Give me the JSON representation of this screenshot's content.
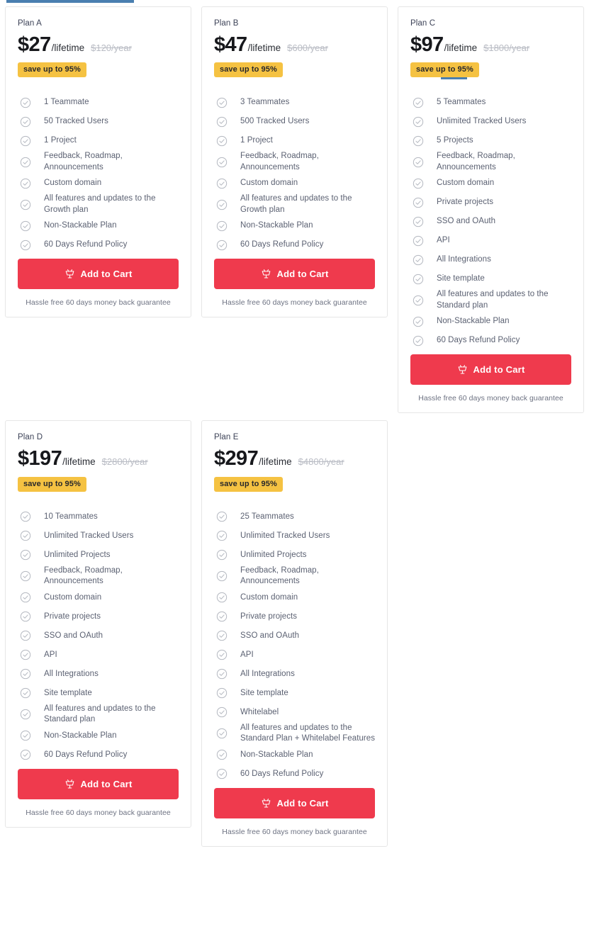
{
  "page": {
    "loading_bar_color": "#4a7fb0",
    "accent_button_color": "#ef3a4d",
    "badge_color": "#f5c242"
  },
  "common": {
    "cart_label": "Add to Cart",
    "cart_icon": "shopping-cart-icon",
    "guarantee": "Hassle free 60 days money back guarantee",
    "check_icon": "check-circle-icon",
    "save_badge": "save up to 95%",
    "period": "/lifetime"
  },
  "plans": [
    {
      "name": "Plan A",
      "price": "$27",
      "period": "/lifetime",
      "old_price": "$120/year",
      "badge": "save up to 95%",
      "badge_underline": false,
      "features": [
        "1 Teammate",
        "50 Tracked Users",
        "1 Project",
        "Feedback, Roadmap, Announcements",
        "Custom domain",
        "All features and updates to the Growth plan",
        "Non-Stackable Plan",
        "60 Days Refund Policy"
      ],
      "cta": "Add to Cart",
      "guarantee": "Hassle free 60 days money back guarantee"
    },
    {
      "name": "Plan B",
      "price": "$47",
      "period": "/lifetime",
      "old_price": "$600/year",
      "badge": "save up to 95%",
      "badge_underline": false,
      "features": [
        "3 Teammates",
        "500 Tracked Users",
        "1 Project",
        "Feedback, Roadmap, Announcements",
        "Custom domain",
        "All features and updates to the Growth plan",
        "Non-Stackable Plan",
        "60 Days Refund Policy"
      ],
      "cta": "Add to Cart",
      "guarantee": "Hassle free 60 days money back guarantee"
    },
    {
      "name": "Plan C",
      "price": "$97",
      "period": "/lifetime",
      "old_price": "$1800/year",
      "badge": "save up to 95%",
      "badge_underline": true,
      "features": [
        "5 Teammates",
        "Unlimited Tracked Users",
        "5 Projects",
        "Feedback, Roadmap, Announcements",
        "Custom domain",
        "Private projects",
        "SSO and OAuth",
        "API",
        "All Integrations",
        "Site template",
        "All features and updates to the Standard plan",
        "Non-Stackable Plan",
        "60 Days Refund Policy"
      ],
      "cta": "Add to Cart",
      "guarantee": "Hassle free 60 days money back guarantee"
    },
    {
      "name": "Plan D",
      "price": "$197",
      "period": "/lifetime",
      "old_price": "$2800/year",
      "badge": "save up to 95%",
      "badge_underline": false,
      "features": [
        "10 Teammates",
        "Unlimited Tracked Users",
        "Unlimited Projects",
        "Feedback, Roadmap, Announcements",
        "Custom domain",
        "Private projects",
        "SSO and OAuth",
        "API",
        "All Integrations",
        "Site template",
        "All features and updates to the Standard plan",
        "Non-Stackable Plan",
        "60 Days Refund Policy"
      ],
      "cta": "Add to Cart",
      "guarantee": "Hassle free 60 days money back guarantee"
    },
    {
      "name": "Plan E",
      "price": "$297",
      "period": "/lifetime",
      "old_price": "$4800/year",
      "badge": "save up to 95%",
      "badge_underline": false,
      "features": [
        "25 Teammates",
        "Unlimited Tracked Users",
        "Unlimited Projects",
        "Feedback, Roadmap, Announcements",
        "Custom domain",
        "Private projects",
        "SSO and OAuth",
        "API",
        "All Integrations",
        "Site template",
        "Whitelabel",
        "All features and updates to the Standard Plan + Whitelabel Features",
        "Non-Stackable Plan",
        "60 Days Refund Policy"
      ],
      "cta": "Add to Cart",
      "guarantee": "Hassle free 60 days money back guarantee"
    }
  ]
}
